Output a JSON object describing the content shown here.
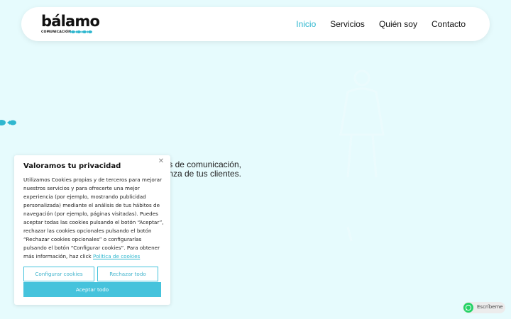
{
  "brand": {
    "wordmark": "bálamo",
    "tagline": "COMUNICACIÓN",
    "accent_color": "#2fb7cf"
  },
  "nav": {
    "items": [
      {
        "label": "Inicio",
        "active": true
      },
      {
        "label": "Servicios",
        "active": false
      },
      {
        "label": "Quién soy",
        "active": false
      },
      {
        "label": "Contacto",
        "active": false
      }
    ]
  },
  "hero": {
    "line1": "s de comunicación,",
    "line2": "fianza de tus clientes."
  },
  "cookie_banner": {
    "title": "Valoramos tu privacidad",
    "body": "Utilizamos Cookies propias y de terceros para mejorar nuestros servicios y para ofrecerte una mejor experiencia (por ejemplo, mostrando publicidad personalizada) mediante el análisis de tus hábitos de navegación (por ejemplo, páginas visitadas). Puedes aceptar todas las cookies pulsando el botón “Aceptar”, rechazar las cookies opcionales pulsando el botón “Rechazar cookies opcionales” o configurarlas pulsando el botón “Configurar cookies”. Para obtener más información, haz click",
    "policy_link": "Política de cookies",
    "configure_label": "Configurar cookies",
    "reject_label": "Rechazar todo",
    "accept_label": "Aceptar todo",
    "close_icon": "close-icon"
  },
  "whatsapp": {
    "label": "Escríbeme",
    "icon": "whatsapp-icon"
  }
}
